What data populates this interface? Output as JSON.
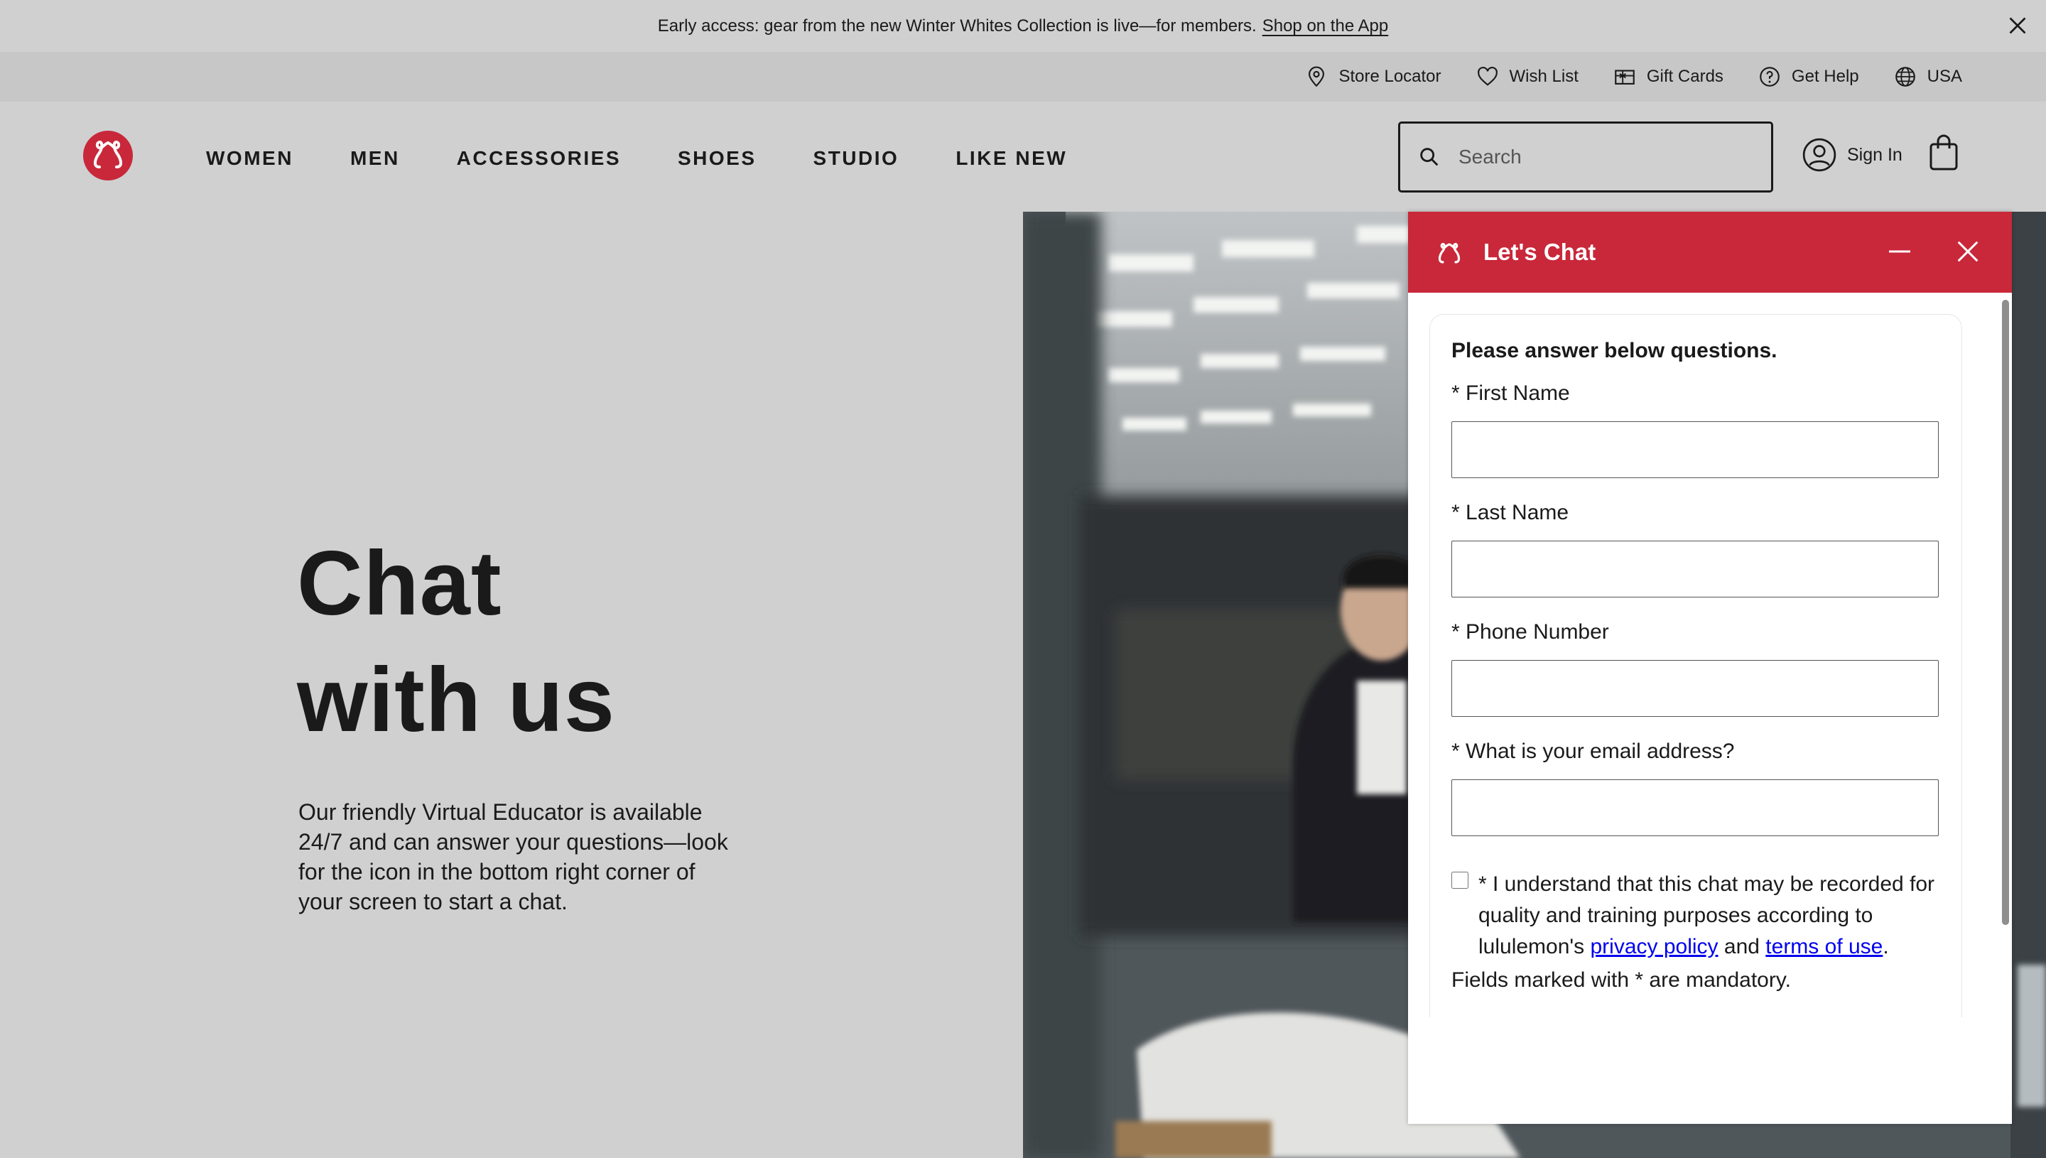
{
  "promo": {
    "text": "Early access: gear from the new Winter Whites Collection is live—for members.",
    "link": "Shop on the App"
  },
  "utility": {
    "items": [
      {
        "label": "Store Locator",
        "icon": "location-pin-icon"
      },
      {
        "label": "Wish List",
        "icon": "heart-icon"
      },
      {
        "label": "Gift Cards",
        "icon": "gift-card-icon"
      },
      {
        "label": "Get Help",
        "icon": "help-circle-icon"
      },
      {
        "label": "USA",
        "icon": "globe-icon"
      }
    ]
  },
  "nav": {
    "items": [
      "WOMEN",
      "MEN",
      "ACCESSORIES",
      "SHOES",
      "STUDIO",
      "LIKE NEW"
    ]
  },
  "search": {
    "placeholder": "Search"
  },
  "account": {
    "signin": "Sign In"
  },
  "hero": {
    "title_line1": "Chat",
    "title_line2": "with us",
    "body": "Our friendly Virtual Educator is available 24/7 and can answer your questions—look for the icon in the bottom right corner of your screen to start a chat."
  },
  "chat": {
    "title": "Let's Chat",
    "heading": "Please answer below questions.",
    "fields": [
      {
        "label": "* First Name",
        "value": ""
      },
      {
        "label": "* Last Name",
        "value": ""
      },
      {
        "label": "* Phone Number",
        "value": ""
      },
      {
        "label": "* What is your email address?",
        "value": ""
      }
    ],
    "consent_prefix": "* I understand that this chat may be recorded for quality and training purposes according to lululemon's",
    "privacy_link": "privacy policy",
    "consent_and": "and",
    "terms_link": "terms of use",
    "consent_suffix": ".",
    "consent_checked": false,
    "mandatory_note": "Fields marked with * are mandatory.",
    "accent_color": "#c8283a"
  },
  "colors": {
    "background": "#d0d0d0",
    "utility_bar": "#c7c7c7",
    "link": "#0000ee"
  }
}
